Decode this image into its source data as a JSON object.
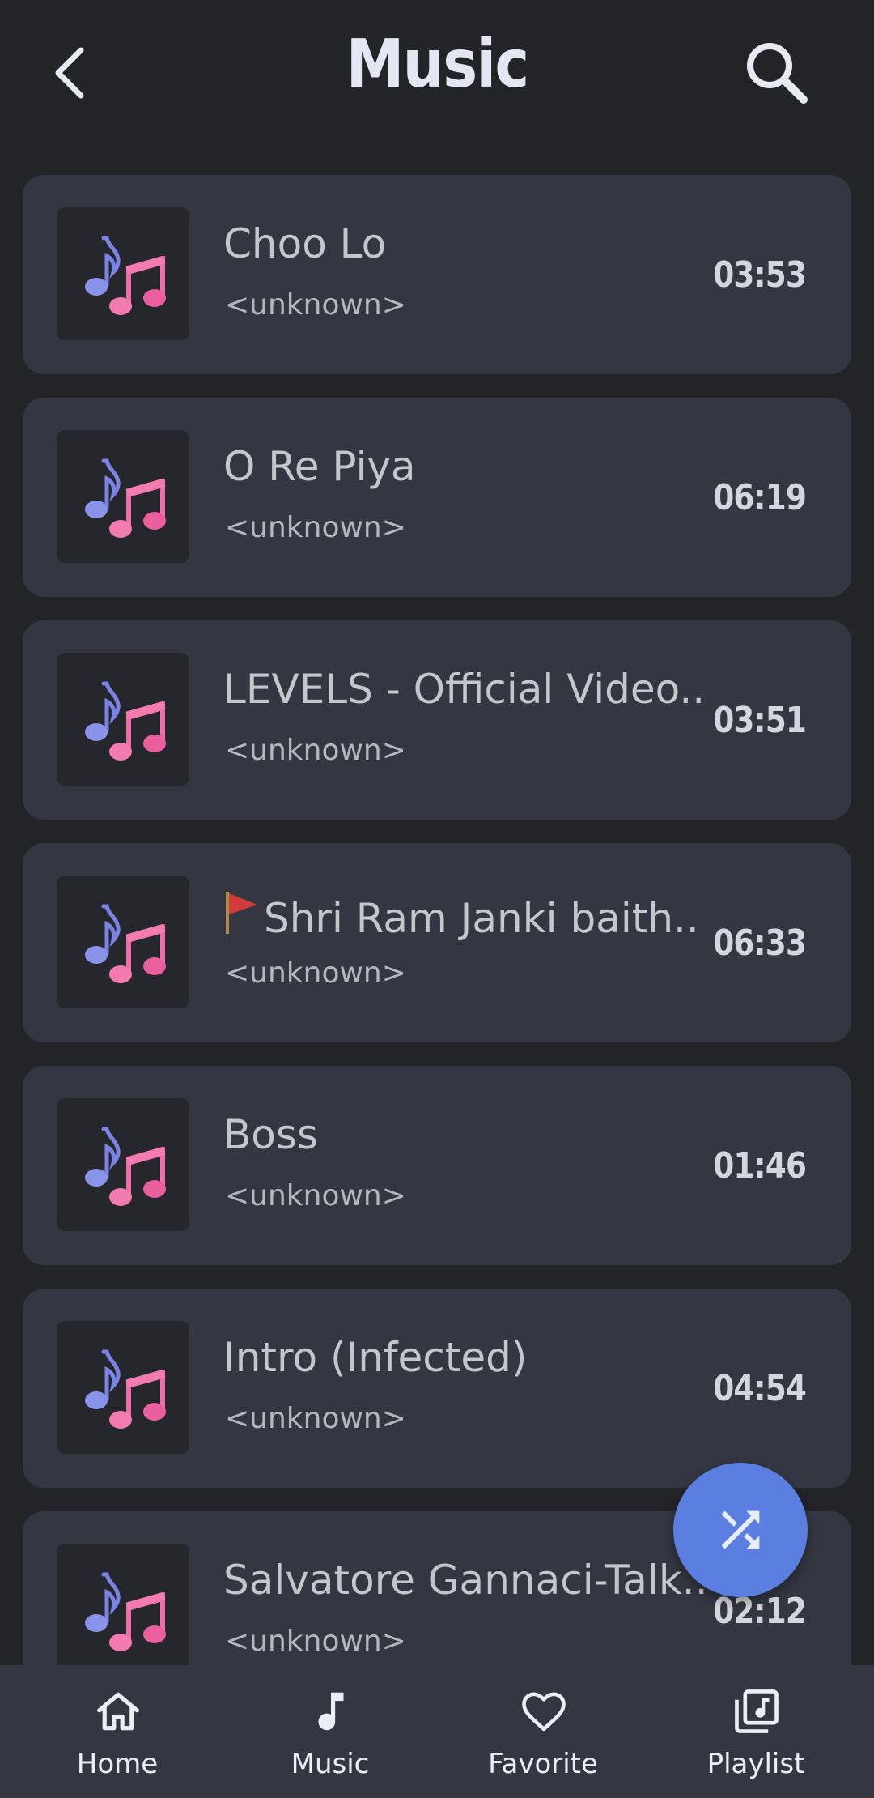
{
  "header": {
    "title": "Music",
    "back_icon": "chevron-left-icon",
    "search_icon": "search-icon"
  },
  "songs": [
    {
      "title": "Choo Lo",
      "artist": "<unknown>",
      "duration": "03:53"
    },
    {
      "title": "O Re Piya",
      "artist": "<unknown>",
      "duration": "06:19"
    },
    {
      "title": "LEVELS - Official Video..",
      "artist": "<unknown>",
      "duration": "03:51"
    },
    {
      "title": "Shri Ram Janki baith..",
      "artist": "<unknown>",
      "duration": "06:33",
      "prefix_icon": "red-flag-icon"
    },
    {
      "title": "Boss",
      "artist": "<unknown>",
      "duration": "01:46"
    },
    {
      "title": "Intro (Infected)",
      "artist": "<unknown>",
      "duration": "04:54"
    },
    {
      "title": "Salvatore Gannaci-Talk..",
      "artist": "<unknown>",
      "duration": "02:12"
    }
  ],
  "fab": {
    "icon": "shuffle-icon"
  },
  "bottom_nav": [
    {
      "label": "Home",
      "icon": "home-icon"
    },
    {
      "label": "Music",
      "icon": "music-note-icon"
    },
    {
      "label": "Favorite",
      "icon": "heart-icon"
    },
    {
      "label": "Playlist",
      "icon": "playlist-icon"
    }
  ],
  "colors": {
    "background": "#222428",
    "card": "#343741",
    "accent": "#5b7fe0",
    "note_blue": "#7b84e4",
    "note_pink": "#f06ea8"
  }
}
